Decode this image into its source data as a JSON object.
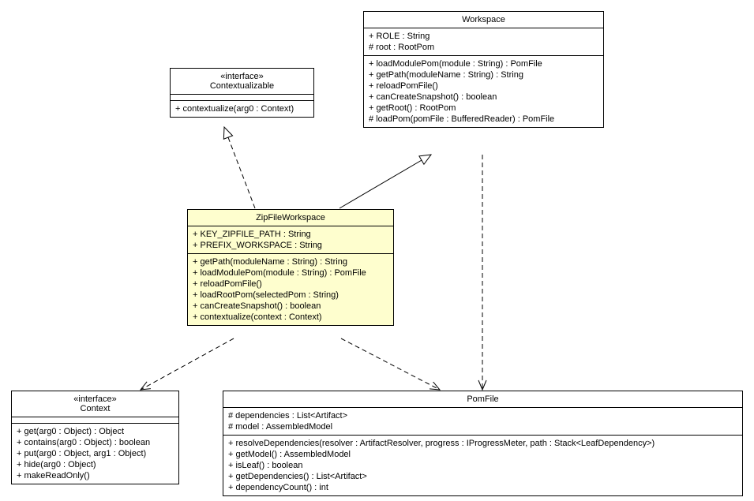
{
  "classes": {
    "contextualizable": {
      "stereotype": "«interface»",
      "name": "Contextualizable",
      "attributes": [],
      "operations": [
        "+ contextualize(arg0 : Context)"
      ]
    },
    "workspace": {
      "stereotype": null,
      "name": "Workspace",
      "attributes": [
        "+ ROLE : String",
        "# root : RootPom"
      ],
      "operations": [
        "+ loadModulePom(module : String) : PomFile",
        "+ getPath(moduleName : String) : String",
        "+ reloadPomFile()",
        "+ canCreateSnapshot() : boolean",
        "+ getRoot() : RootPom",
        "# loadPom(pomFile : BufferedReader) : PomFile"
      ]
    },
    "zipfileworkspace": {
      "stereotype": null,
      "name": "ZipFileWorkspace",
      "attributes": [
        "+ KEY_ZIPFILE_PATH : String",
        "+ PREFIX_WORKSPACE : String"
      ],
      "operations": [
        "+ getPath(moduleName : String) : String",
        "+ loadModulePom(module : String) : PomFile",
        "+ reloadPomFile()",
        "+ loadRootPom(selectedPom : String)",
        "+ canCreateSnapshot() : boolean",
        "+ contextualize(context : Context)"
      ]
    },
    "context": {
      "stereotype": "«interface»",
      "name": "Context",
      "attributes": [],
      "operations": [
        "+ get(arg0 : Object) : Object",
        "+ contains(arg0 : Object) : boolean",
        "+ put(arg0 : Object, arg1 : Object)",
        "+ hide(arg0 : Object)",
        "+ makeReadOnly()"
      ]
    },
    "pomfile": {
      "stereotype": null,
      "name": "PomFile",
      "attributes": [
        "# dependencies : List<Artifact>",
        "# model : AssembledModel"
      ],
      "operations": [
        "+ resolveDependencies(resolver : ArtifactResolver, progress : IProgressMeter, path : Stack<LeafDependency>)",
        "+ getModel() : AssembledModel",
        "+ isLeaf() : boolean",
        "+ getDependencies() : List<Artifact>",
        "+ dependencyCount() : int"
      ]
    }
  },
  "chart_data": {
    "type": "uml-class-diagram",
    "classes": [
      {
        "name": "Contextualizable",
        "kind": "interface",
        "attributes": [],
        "operations": [
          "contextualize(arg0 : Context)"
        ]
      },
      {
        "name": "Workspace",
        "kind": "class",
        "attributes": [
          "ROLE : String",
          "root : RootPom"
        ],
        "operations": [
          "loadModulePom(module : String) : PomFile",
          "getPath(moduleName : String) : String",
          "reloadPomFile()",
          "canCreateSnapshot() : boolean",
          "getRoot() : RootPom",
          "loadPom(pomFile : BufferedReader) : PomFile"
        ]
      },
      {
        "name": "ZipFileWorkspace",
        "kind": "class",
        "attributes": [
          "KEY_ZIPFILE_PATH : String",
          "PREFIX_WORKSPACE : String"
        ],
        "operations": [
          "getPath(moduleName : String) : String",
          "loadModulePom(module : String) : PomFile",
          "reloadPomFile()",
          "loadRootPom(selectedPom : String)",
          "canCreateSnapshot() : boolean",
          "contextualize(context : Context)"
        ]
      },
      {
        "name": "Context",
        "kind": "interface",
        "attributes": [],
        "operations": [
          "get(arg0 : Object) : Object",
          "contains(arg0 : Object) : boolean",
          "put(arg0 : Object, arg1 : Object)",
          "hide(arg0 : Object)",
          "makeReadOnly()"
        ]
      },
      {
        "name": "PomFile",
        "kind": "class",
        "attributes": [
          "dependencies : List<Artifact>",
          "model : AssembledModel"
        ],
        "operations": [
          "resolveDependencies(resolver : ArtifactResolver, progress : IProgressMeter, path : Stack<LeafDependency>)",
          "getModel() : AssembledModel",
          "isLeaf() : boolean",
          "getDependencies() : List<Artifact>",
          "dependencyCount() : int"
        ]
      }
    ],
    "relationships": [
      {
        "from": "ZipFileWorkspace",
        "to": "Contextualizable",
        "type": "realization"
      },
      {
        "from": "ZipFileWorkspace",
        "to": "Workspace",
        "type": "generalization"
      },
      {
        "from": "ZipFileWorkspace",
        "to": "Context",
        "type": "dependency"
      },
      {
        "from": "ZipFileWorkspace",
        "to": "PomFile",
        "type": "dependency"
      },
      {
        "from": "Workspace",
        "to": "PomFile",
        "type": "dependency"
      }
    ]
  }
}
